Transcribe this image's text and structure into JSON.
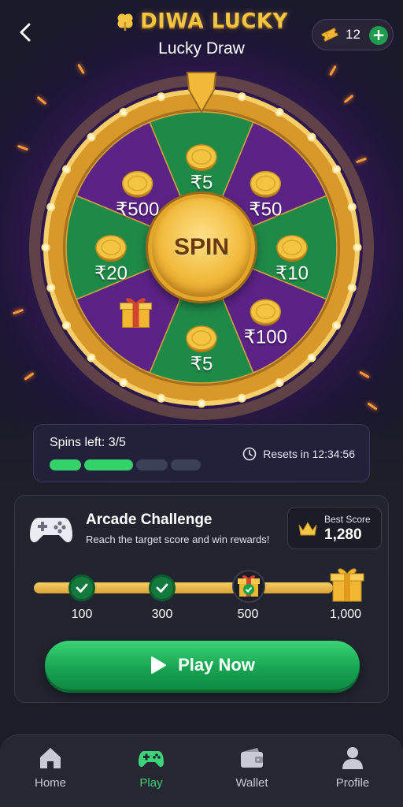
{
  "header": {
    "title": "DIWA LUCKY",
    "subtitle": "Lucky Draw",
    "back_icon": "chevron-left-icon",
    "logo_icon": "clover-icon",
    "tickets": {
      "icon": "ticket-icon",
      "count": "12",
      "add_icon": "plus-icon"
    }
  },
  "wheel": {
    "spin_label": "SPIN",
    "slices": [
      {
        "label": "₹5",
        "color": "#1f8a48",
        "icon": "coin-icon"
      },
      {
        "label": "₹50",
        "color": "#5b2386",
        "icon": "coin-icon"
      },
      {
        "label": "₹10",
        "color": "#1f8a48",
        "icon": "coin-icon"
      },
      {
        "label": "₹100",
        "color": "#5b2386",
        "icon": "coin-icon"
      },
      {
        "label": "₹5",
        "color": "#1f8a48",
        "icon": "coin-icon"
      },
      {
        "label": "",
        "color": "#5b2386",
        "icon": "gift-icon"
      },
      {
        "label": "₹20",
        "color": "#1f8a48",
        "icon": "coin-icon"
      },
      {
        "label": "₹500",
        "color": "#5b2386",
        "icon": "coin-icon"
      }
    ]
  },
  "spins": {
    "text": "Spins left: 3/5",
    "used": 3,
    "total": 5,
    "reset_text": "Resets in 12:34:56"
  },
  "challenge": {
    "title": "Arcade Challenge",
    "subtitle": "Reach the target score and win rewards!",
    "best_label": "Best Score",
    "best_value": "1,280",
    "milestones": [
      "100",
      "300",
      "500",
      "1,000"
    ],
    "play_label": "Play Now"
  },
  "nav": {
    "items": [
      {
        "label": "Home",
        "icon": "home-icon"
      },
      {
        "label": "Play",
        "icon": "gamepad-icon"
      },
      {
        "label": "Wallet",
        "icon": "wallet-icon"
      },
      {
        "label": "Profile",
        "icon": "profile-icon"
      }
    ],
    "active": "Play"
  },
  "colors": {
    "accent_green": "#34d36a",
    "gold": "#f4c542",
    "purple": "#5b2386"
  }
}
